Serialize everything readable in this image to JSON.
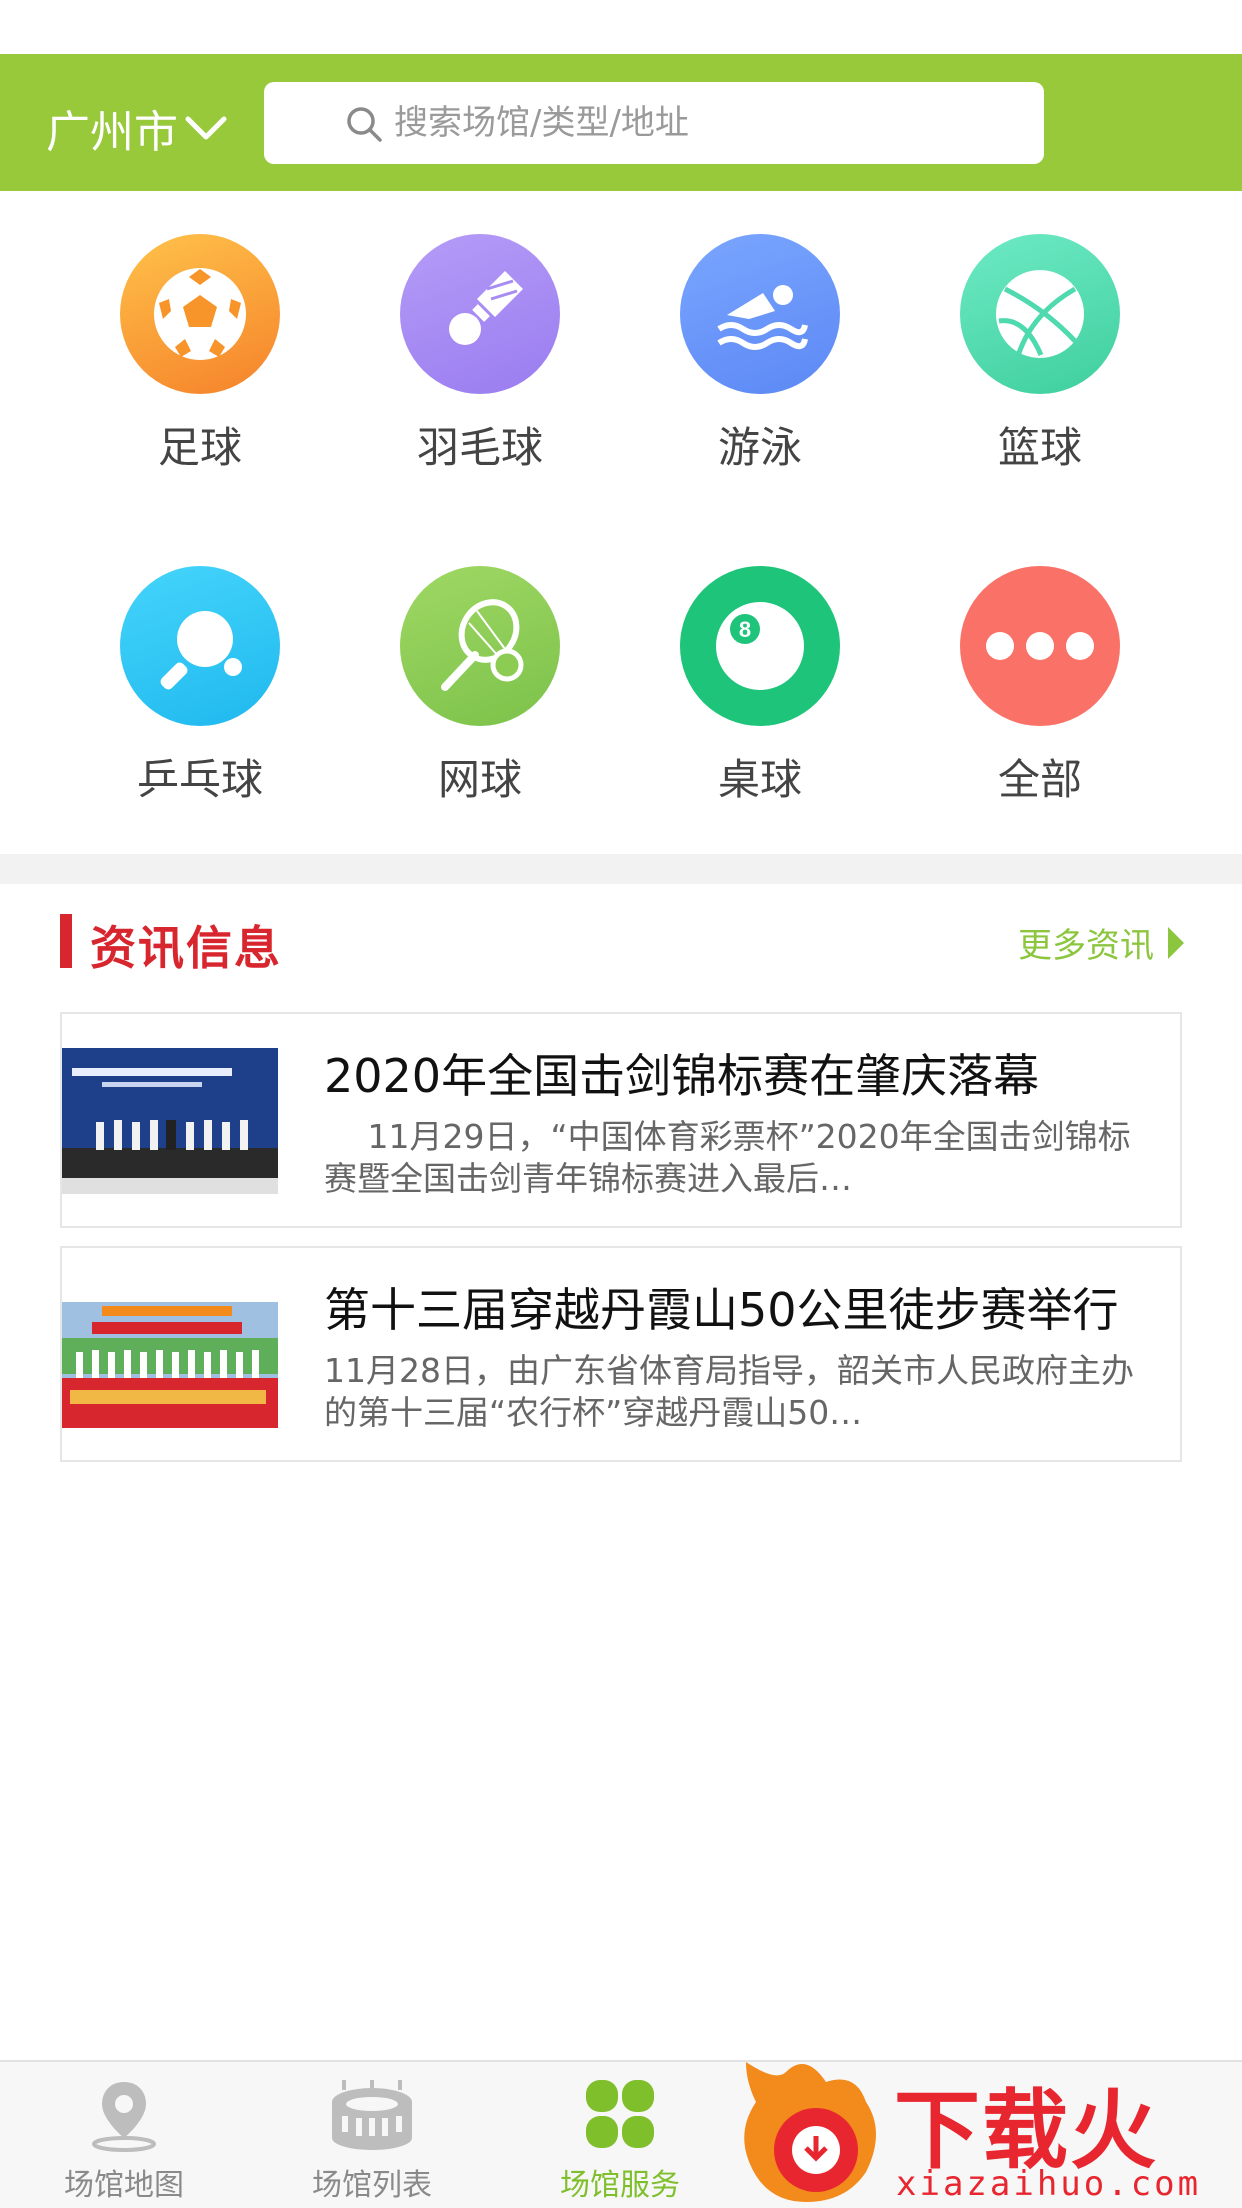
{
  "header": {
    "city": "广州市",
    "search_placeholder": "搜索场馆/类型/地址",
    "bg_color": "#97c93a"
  },
  "categories": [
    {
      "label": "足球",
      "icon": "soccer-ball-icon",
      "color": "#f7942a"
    },
    {
      "label": "羽毛球",
      "icon": "shuttlecock-icon",
      "color": "#a88cf2"
    },
    {
      "label": "游泳",
      "icon": "swimmer-icon",
      "color": "#6a98ff"
    },
    {
      "label": "篮球",
      "icon": "basketball-icon",
      "color": "#4fd9ae"
    },
    {
      "label": "乒乓球",
      "icon": "ping-pong-paddle-icon",
      "color": "#2fc8f4"
    },
    {
      "label": "网球",
      "icon": "tennis-racket-icon",
      "color": "#8dcc53"
    },
    {
      "label": "桌球",
      "icon": "billiard-8-ball-icon",
      "color": "#1ec47a"
    },
    {
      "label": "全部",
      "icon": "more-dots-icon",
      "color": "#fa7168"
    }
  ],
  "news": {
    "title": "资讯信息",
    "more_label": "更多资讯",
    "items": [
      {
        "title": "2020年全国击剑锦标赛在肇庆落幕",
        "desc": "　 11月29日，“中国体育彩票杯”2020年全国击剑锦标赛暨全国击剑青年锦标赛进入最后…"
      },
      {
        "title": "第十三届穿越丹霞山50公里徒步赛举行",
        "desc": "11月28日，由广东省体育局指导，韶关市人民政府主办的第十三届“农行杯”穿越丹霞山50…"
      }
    ]
  },
  "tabbar": {
    "tabs": [
      {
        "label": "场馆地图",
        "icon": "map-pin-icon"
      },
      {
        "label": "场馆列表",
        "icon": "stadium-icon"
      },
      {
        "label": "场馆服务",
        "icon": "clover-icon"
      }
    ],
    "active_color": "#7fbf2c"
  },
  "watermark": {
    "text": "下载火",
    "sub": "xiazaihuo.com"
  }
}
